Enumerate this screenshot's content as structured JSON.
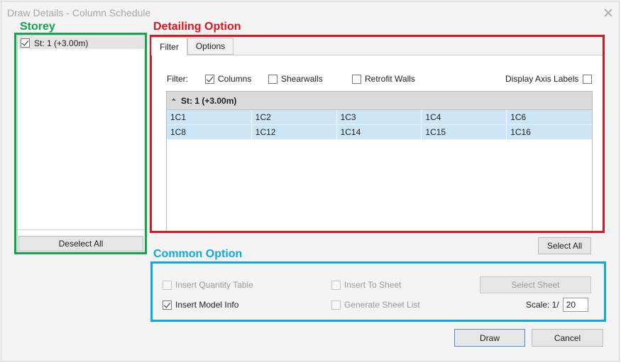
{
  "window": {
    "title": "Draw Details - Column Schedule"
  },
  "annotations": {
    "storey": "Storey",
    "detailing_option": "Detailing Option",
    "common_option": "Common Option"
  },
  "colors": {
    "green": "#14a44d",
    "red": "#e3141b",
    "blue": "#11a9dd",
    "selection": "#cde6f7"
  },
  "storey_panel": {
    "items": [
      {
        "label": "St: 1 (+3.00m)",
        "checked": true
      }
    ],
    "deselect_all": "Deselect All"
  },
  "tabs": [
    {
      "label": "Filter",
      "active": true
    },
    {
      "label": "Options",
      "active": false
    }
  ],
  "filter": {
    "label": "Filter:",
    "columns": {
      "label": "Columns",
      "checked": true
    },
    "shearwalls": {
      "label": "Shearwalls",
      "checked": false
    },
    "retrofit_walls": {
      "label": "Retrofit Walls",
      "checked": false
    },
    "display_axis_labels": {
      "label": "Display Axis Labels",
      "checked": false
    }
  },
  "grid": {
    "group_header": "St: 1 (+3.00m)",
    "rows": [
      [
        "1C1",
        "1C2",
        "1C3",
        "1C4",
        "1C6"
      ],
      [
        "1C8",
        "1C12",
        "1C14",
        "1C15",
        "1C16"
      ]
    ]
  },
  "select_all": "Select All",
  "common": {
    "insert_quantity_table": {
      "label": "Insert Quantity Table",
      "checked": false,
      "enabled": false
    },
    "insert_to_sheet": {
      "label": "Insert To Sheet",
      "checked": false,
      "enabled": false
    },
    "select_sheet": "Select Sheet",
    "insert_model_info": {
      "label": "Insert Model Info",
      "checked": true,
      "enabled": true
    },
    "generate_sheet_list": {
      "label": "Generate Sheet List",
      "checked": false,
      "enabled": false
    },
    "scale_label": "Scale: 1/",
    "scale_value": "20"
  },
  "footer": {
    "draw": "Draw",
    "cancel": "Cancel"
  }
}
